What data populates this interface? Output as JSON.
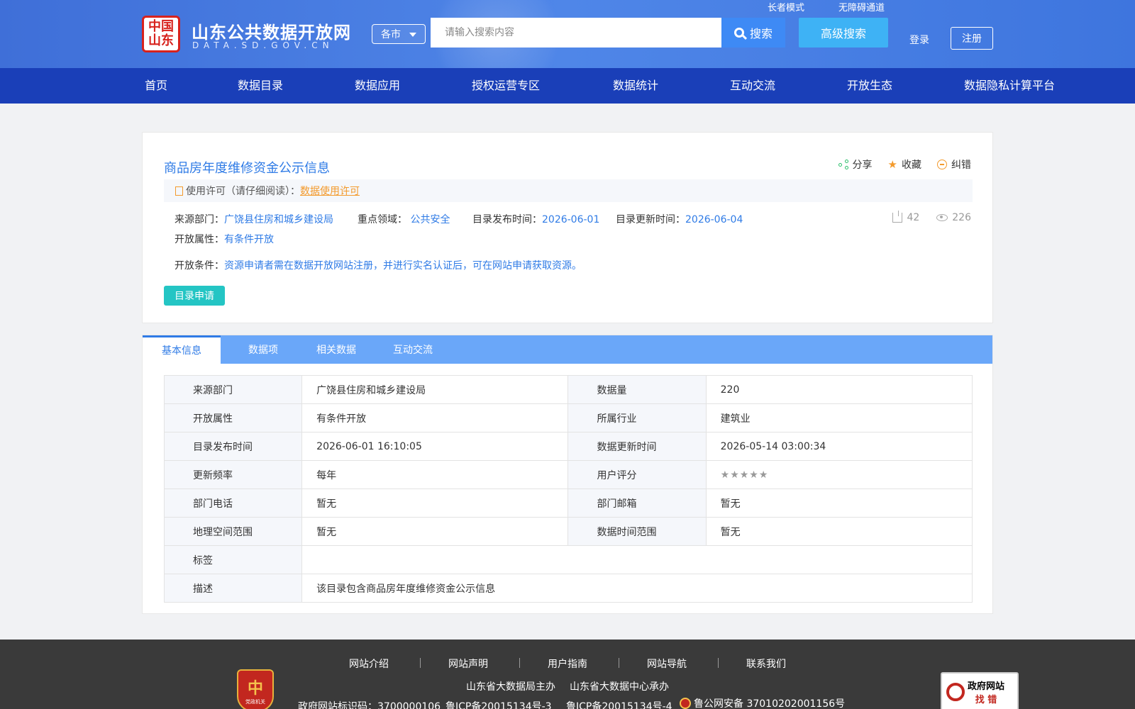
{
  "header": {
    "logo_seal": "中国山东",
    "site_title": "山东公共数据开放网",
    "site_domain": "DATA.SD.GOV.CN",
    "city_select": "各市",
    "search_placeholder": "请输入搜索内容",
    "search_label": "搜索",
    "advanced_search_label": "高级搜索",
    "elder_mode": "长者模式",
    "accessibility": "无障碍通道",
    "login": "登录",
    "register": "注册"
  },
  "nav": [
    "首页",
    "数据目录",
    "数据应用",
    "授权运营专区",
    "数据统计",
    "互动交流",
    "开放生态",
    "数据隐私计算平台"
  ],
  "dataset": {
    "title": "商品房年度维修资金公示信息",
    "actions": {
      "share": "分享",
      "favorite": "收藏",
      "report": "纠错"
    },
    "license_label": "使用许可（请仔细阅读）：",
    "license_link": "数据使用许可",
    "source_label": "来源部门：",
    "source_value": "广饶县住房和城乡建设局",
    "domain_label": "重点领域：",
    "domain_value": "公共安全",
    "publish_label": "目录发布时间：",
    "publish_value": "2026-06-01",
    "update_label": "目录更新时间：",
    "update_value": "2026-06-04",
    "downloads": "42",
    "views": "226",
    "open_attr_label": "开放属性：",
    "open_attr_value": "有条件开放",
    "open_cond_label": "开放条件：",
    "open_cond_value": "资源申请者需在数据开放网站注册，并进行实名认证后，可在网站申请获取资源。",
    "apply_label": "目录申请"
  },
  "tabs": [
    "基本信息",
    "数据项",
    "相关数据",
    "互动交流"
  ],
  "info_rows": [
    [
      "来源部门",
      "广饶县住房和城乡建设局",
      "数据量",
      "220"
    ],
    [
      "开放属性",
      "有条件开放",
      "所属行业",
      "建筑业"
    ],
    [
      "目录发布时间",
      "2026-06-01 16:10:05",
      "数据更新时间",
      "2026-05-14 03:00:34"
    ],
    [
      "更新频率",
      "每年",
      "用户评分",
      ""
    ],
    [
      "部门电话",
      "暂无",
      "部门邮箱",
      "暂无"
    ],
    [
      "地理空间范围",
      "暂无",
      "数据时间范围",
      "暂无"
    ]
  ],
  "info_tag_label": "标签",
  "info_tag_value": "",
  "info_desc_label": "描述",
  "info_desc_value": "该目录包含商品房年度维修资金公示信息",
  "footer": {
    "links": [
      "网站介绍",
      "网站声明",
      "用户指南",
      "网站导航",
      "联系我们"
    ],
    "host": "山东省大数据局主办",
    "organizer": "山东省大数据中心承办",
    "gov_code": "政府网站标识码：3700000106",
    "icp1": "鲁ICP备20015134号-3",
    "icp2": "鲁ICP备20015134号-4",
    "police": "鲁公网安备 37010202001156号",
    "party_badge": "党政机关",
    "gov_error_1": "政府网站",
    "gov_error_2": "找 错"
  }
}
